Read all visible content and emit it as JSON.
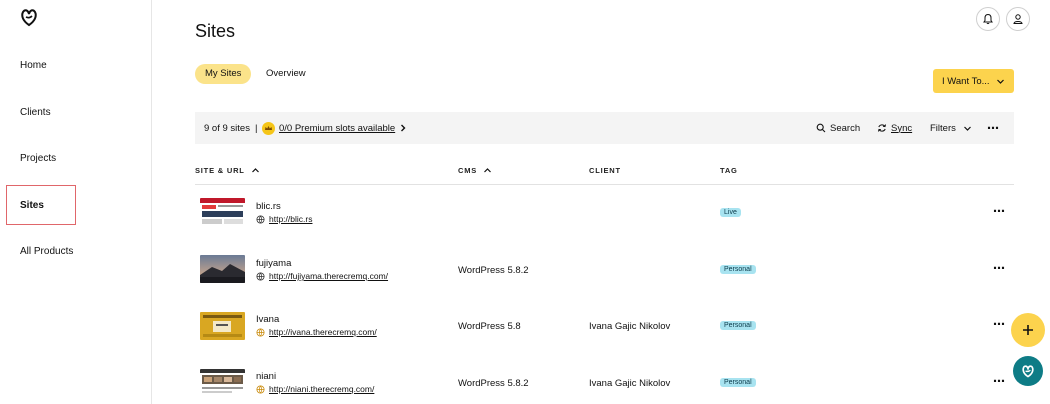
{
  "sidebar": {
    "items": [
      {
        "label": "Home"
      },
      {
        "label": "Clients"
      },
      {
        "label": "Projects"
      },
      {
        "label": "Sites"
      },
      {
        "label": "All Products"
      }
    ],
    "active": "Sites",
    "active_border_color": "#e0666a"
  },
  "header": {
    "title": "Sites",
    "icons": [
      "bell-icon",
      "user-icon"
    ]
  },
  "tabs": [
    {
      "label": "My Sites",
      "active": true
    },
    {
      "label": "Overview",
      "active": false
    }
  ],
  "actions": {
    "i_want_to": "I Want To..."
  },
  "toolbar": {
    "count": "9 of 9 sites",
    "separator": "|",
    "premium": "0/0 Premium slots available",
    "search": "Search",
    "sync": "Sync",
    "filters": "Filters"
  },
  "table": {
    "columns": [
      "SITE & URL",
      "CMS",
      "CLIENT",
      "TAG"
    ],
    "rows": [
      {
        "name": "blic.rs",
        "url": "http://blic.rs",
        "cms": "",
        "client": "",
        "tag": "Live"
      },
      {
        "name": "fujiyama",
        "url": "http://fujiyama.therecremq.com/",
        "cms": "WordPress 5.8.2",
        "client": "",
        "tag": "Personal"
      },
      {
        "name": "Ivana",
        "url": "http://ivana.therecremq.com/",
        "cms": "WordPress 5.8",
        "client": "Ivana Gajic Nikolov",
        "tag": "Personal"
      },
      {
        "name": "niani",
        "url": "http://niani.therecremq.com/",
        "cms": "WordPress 5.8.2",
        "client": "Ivana Gajic Nikolov",
        "tag": "Personal"
      }
    ]
  },
  "colors": {
    "accent_yellow": "#fcd34d",
    "tab_active": "#fbe38a",
    "tag_bg": "#a8e3f0",
    "chat_teal": "#0e7c86"
  }
}
